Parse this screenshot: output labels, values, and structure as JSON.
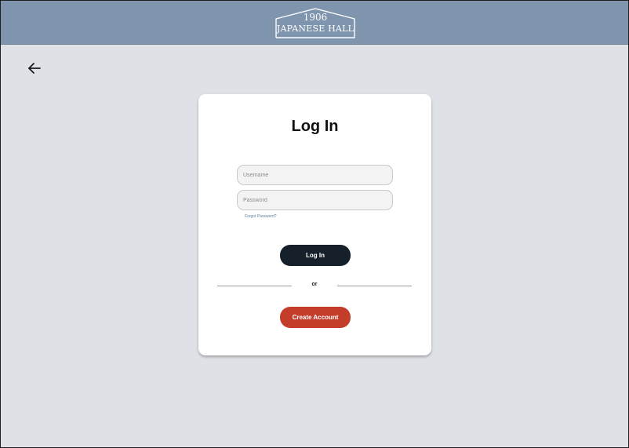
{
  "header": {
    "logo_year": "1906",
    "logo_name": "JAPANESE HALL",
    "background_color": "#7f94ad"
  },
  "nav": {
    "back_icon": "arrow-left-icon"
  },
  "login_card": {
    "title": "Log In",
    "username_placeholder": "Username",
    "password_placeholder": "Password",
    "forgot_password": "Forgot Password?",
    "login_button": "Log In",
    "divider_text": "or",
    "create_account_button": "Create Account"
  },
  "colors": {
    "page_background": "#dee1e5",
    "login_button": "#16202a",
    "create_account_button": "#c43d2b",
    "link": "#5d7fa0"
  }
}
